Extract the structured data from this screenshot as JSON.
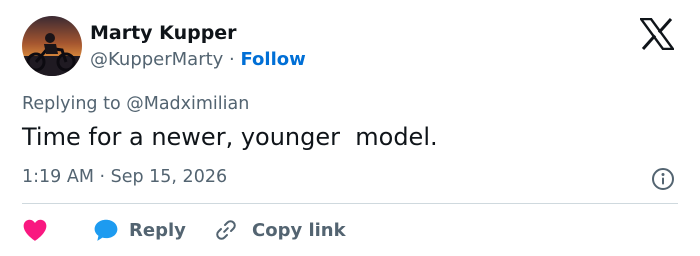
{
  "user": {
    "display_name": "Marty Kupper",
    "handle": "@KupperMarty",
    "separator": " · ",
    "follow_label": "Follow"
  },
  "tweet": {
    "replying_prefix": "Replying to ",
    "replying_to": "@Madximilian",
    "text": "Time for a newer, younger  model.",
    "timestamp": "1:19 AM · Sep 15, 2026"
  },
  "actions": {
    "reply_label": "Reply",
    "copy_link_label": "Copy link"
  },
  "icons": {
    "brand": "x-logo-icon",
    "info": "info-icon",
    "like": "heart-icon",
    "reply": "speech-bubble-icon",
    "copy": "link-icon"
  },
  "colors": {
    "text": "#0f1419",
    "secondary": "#536471",
    "follow": "#006fd6",
    "heart": "#f91880",
    "reply_bubble": "#1d9bf0",
    "divider": "#cfd9de"
  }
}
